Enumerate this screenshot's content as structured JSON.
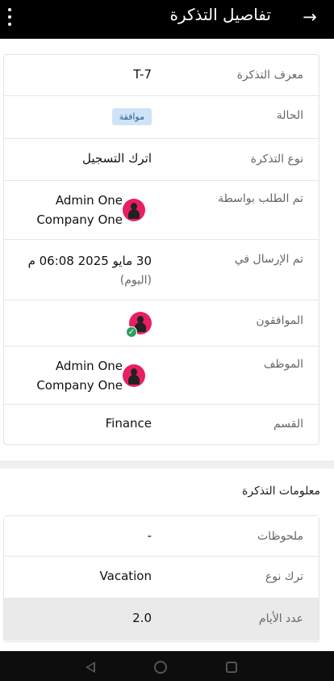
{
  "appbar": {
    "title": "تفاصيل التذكرة",
    "back_icon": "arrow-back-icon",
    "menu_icon": "more-vert-icon"
  },
  "details": {
    "ticket_id_label": "معرف التذكرة",
    "ticket_id_value": "T-7",
    "status_label": "الحالة",
    "status_value": "موافقة",
    "ticket_type_label": "نوع التذكرة",
    "ticket_type_value": "اترك التسجيل",
    "requested_by_label": "تم الطلب بواسطة",
    "requested_by_name": "Admin One",
    "requested_by_company": "Company One",
    "sent_at_label": "تم الإرسال في",
    "sent_at_value": "30 مايو 2025 06:08 م",
    "sent_at_relative": "(اليوم)",
    "approvers_label": "الموافقون",
    "employee_label": "الموظف",
    "employee_name": "Admin One",
    "employee_company": "Company One",
    "department_label": "القسم",
    "department_value": "Finance"
  },
  "info": {
    "section_title": "معلومات التذكرة",
    "notes_label": "ملحوظات",
    "notes_value": "-",
    "leave_type_label": "ترك نوع",
    "leave_type_value": "Vacation",
    "days_label": "عدد الأيام",
    "days_value": "2.0"
  },
  "colors": {
    "appbar": "#000000",
    "badge_bg": "#cfe3f8",
    "avatar": "#e91e63",
    "approved_check": "#2e9e5e"
  },
  "system_nav": {
    "back_icon": "nav-back-icon",
    "home_icon": "nav-home-icon",
    "recent_icon": "nav-recent-icon"
  }
}
